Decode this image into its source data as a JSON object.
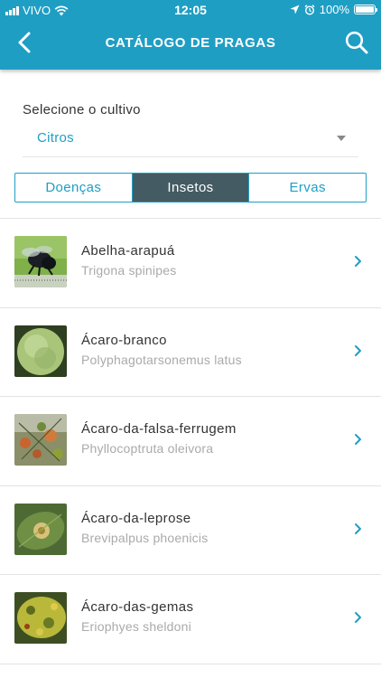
{
  "status_bar": {
    "carrier": "VIVO",
    "time": "12:05",
    "battery": "100%"
  },
  "header": {
    "title": "CATÁLOGO DE PRAGAS",
    "back_icon": "chevron-left-icon",
    "search_icon": "search-icon"
  },
  "crop": {
    "label": "Selecione o cultivo",
    "selected": "Citros"
  },
  "tabs": [
    {
      "label": "Doenças",
      "active": false
    },
    {
      "label": "Insetos",
      "active": true
    },
    {
      "label": "Ervas",
      "active": false
    }
  ],
  "pests": [
    {
      "name": "Abelha-arapuá",
      "scientific": "Trigona spinipes"
    },
    {
      "name": "Ácaro-branco",
      "scientific": "Polyphagotarsonemus latus"
    },
    {
      "name": "Ácaro-da-falsa-ferrugem",
      "scientific": "Phyllocoptruta oleivora"
    },
    {
      "name": "Ácaro-da-leprose",
      "scientific": "Brevipalpus phoenicis"
    },
    {
      "name": "Ácaro-das-gemas",
      "scientific": "Eriophyes sheldoni"
    }
  ],
  "colors": {
    "accent": "#1f9ec4",
    "active_tab": "#455b64"
  }
}
